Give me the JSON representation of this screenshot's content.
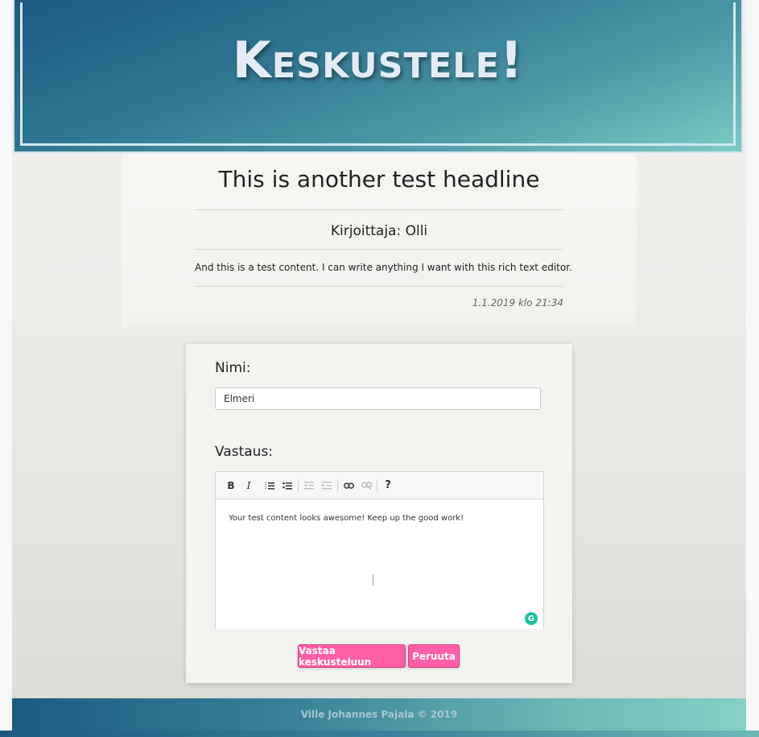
{
  "header": {
    "title": "Keskustele!"
  },
  "post": {
    "title": "This is another test headline",
    "author": "Kirjoittaja: Olli",
    "content": "And this is a test content. I can write anything I want with this rich text editor.",
    "date": "1.1.2019 klo 21:34"
  },
  "form": {
    "name_label": "Nimi:",
    "name_value": "Elmeri",
    "reply_label": "Vastaus:",
    "editor_content": "Your test content looks awesome! Keep up the good work!",
    "toolbar": {
      "bold": "B",
      "italic": "I",
      "help": "?"
    },
    "submit_label": "Vastaa keskusteluun",
    "cancel_label": "Peruuta"
  },
  "footer": {
    "text": "Ville Johannes Pajala © 2019"
  },
  "colors": {
    "accent": "#ff5fa6",
    "header_dark": "#1c5a82",
    "header_light": "#7ccbc6"
  }
}
